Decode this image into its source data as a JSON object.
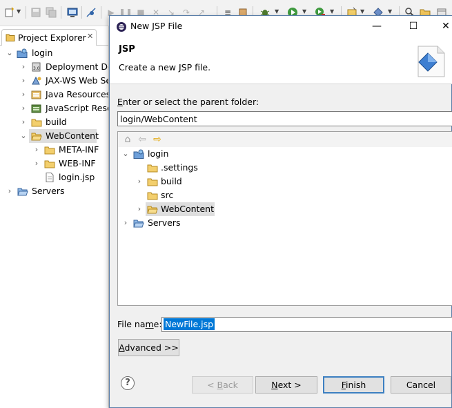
{
  "explorer": {
    "tab_title": "Project Explorer",
    "close_glyph": "✕",
    "tree": [
      {
        "label": "login",
        "icon": "project-icon",
        "expanded": true
      },
      {
        "label": "Deployment Des",
        "icon": "deployment-descriptor-icon"
      },
      {
        "label": "JAX-WS Web Se",
        "icon": "web-service-icon"
      },
      {
        "label": "Java Resources",
        "icon": "java-resources-icon"
      },
      {
        "label": "JavaScript Reso",
        "icon": "javascript-resources-icon"
      },
      {
        "label": "build",
        "icon": "folder-icon"
      },
      {
        "label": "WebContent",
        "icon": "folder-icon",
        "selected": true
      },
      {
        "label": "META-INF",
        "icon": "folder-icon"
      },
      {
        "label": "WEB-INF",
        "icon": "folder-icon"
      },
      {
        "label": "login.jsp",
        "icon": "file-icon"
      },
      {
        "label": "Servers",
        "icon": "folder-icon"
      }
    ]
  },
  "dialog": {
    "title": "New JSP File",
    "window_buttons": {
      "minimize": "—",
      "maximize": "☐",
      "close": "✕"
    },
    "banner_title": "JSP",
    "banner_description": "Create a new JSP file.",
    "parent_folder_label": "Enter or select the parent folder:",
    "parent_folder_value": "login/WebContent",
    "folder_tree": [
      {
        "label": "login",
        "icon": "project-icon"
      },
      {
        "label": ".settings",
        "icon": "folder-icon"
      },
      {
        "label": "build",
        "icon": "folder-icon"
      },
      {
        "label": "src",
        "icon": "folder-icon"
      },
      {
        "label": "WebContent",
        "icon": "folder-icon",
        "selected": true
      },
      {
        "label": "Servers",
        "icon": "folder-icon"
      }
    ],
    "file_name_label": "File name:",
    "file_name_value": "NewFile.jsp",
    "advanced_label": "Advanced >>",
    "help_glyph": "?",
    "buttons": {
      "back": "< Back",
      "next": "Next >",
      "finish": "Finish",
      "cancel": "Cancel"
    }
  },
  "colors": {
    "selection": "#0078d7",
    "folder": "#e8b64a",
    "primary_button_border": "#3c7fc1"
  }
}
